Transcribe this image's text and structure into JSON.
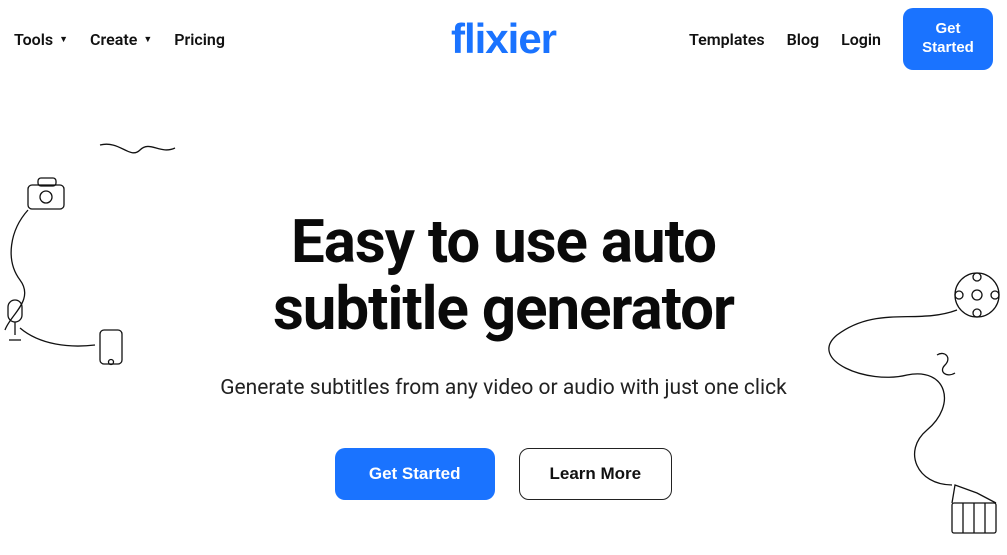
{
  "logo": "flixier",
  "nav": {
    "tools": "Tools",
    "create": "Create",
    "pricing": "Pricing",
    "templates": "Templates",
    "blog": "Blog",
    "login": "Login",
    "get_started": "Get Started"
  },
  "hero": {
    "title_line1": "Easy to use auto",
    "title_line2": "subtitle generator",
    "subtitle": "Generate subtitles from any video or audio with just one click",
    "cta_primary": "Get Started",
    "cta_secondary": "Learn More"
  },
  "colors": {
    "accent": "#1a73ff"
  }
}
